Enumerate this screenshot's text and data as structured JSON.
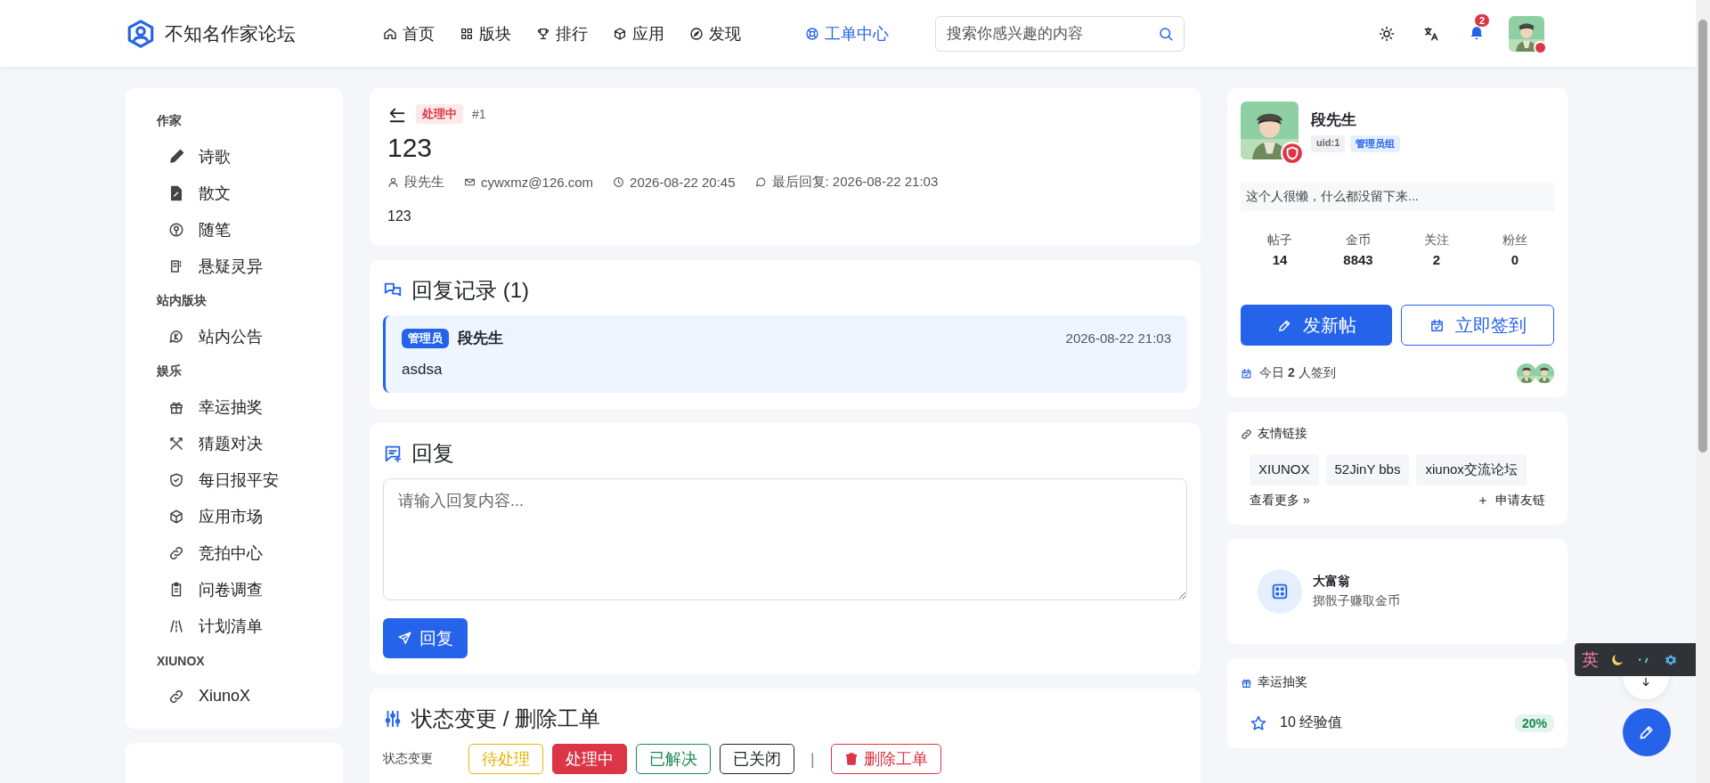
{
  "header": {
    "logo": "不知名作家论坛",
    "nav": [
      {
        "label": "首页",
        "selected": false
      },
      {
        "label": "版块",
        "selected": false
      },
      {
        "label": "排行",
        "selected": false
      },
      {
        "label": "应用",
        "selected": false
      },
      {
        "label": "发现",
        "selected": false
      },
      {
        "label": "工单中心",
        "selected": true
      }
    ],
    "search": {
      "placeholder": "搜索你感兴趣的内容"
    },
    "notification_count": "2"
  },
  "sidebar": {
    "groups": [
      {
        "title": "作家",
        "items": [
          {
            "label": "诗歌"
          },
          {
            "label": "散文"
          },
          {
            "label": "随笔"
          },
          {
            "label": "悬疑灵异"
          }
        ]
      },
      {
        "title": "站内版块",
        "items": [
          {
            "label": "站内公告"
          }
        ]
      },
      {
        "title": "娱乐",
        "items": [
          {
            "label": "幸运抽奖"
          },
          {
            "label": "猜题对决"
          },
          {
            "label": "每日报平安"
          },
          {
            "label": "应用市场"
          },
          {
            "label": "竞拍中心"
          },
          {
            "label": "问卷调查"
          },
          {
            "label": "计划清单"
          }
        ]
      },
      {
        "title": "XIUNOX",
        "items": [
          {
            "label": "XiunoX"
          }
        ]
      }
    ]
  },
  "ticket": {
    "status": "处理中",
    "number": "#1",
    "title": "123",
    "author": "段先生",
    "email": "cywxmz@126.com",
    "created": "2026-08-22 20:45",
    "last_reply": "最后回复: 2026-08-22 21:03",
    "body": "123"
  },
  "replies": {
    "title": "回复记录 (1)",
    "items": [
      {
        "role": "管理员",
        "name": "段先生",
        "time": "2026-08-22 21:03",
        "text": "asdsa"
      }
    ]
  },
  "reply_form": {
    "title": "回复",
    "placeholder": "请输入回复内容...",
    "button": "回复"
  },
  "status_change": {
    "title": "状态变更 / 删除工单",
    "label": "状态变更",
    "options": [
      {
        "label": "待处理",
        "color": "#eab308",
        "selected": false
      },
      {
        "label": "处理中",
        "color": "#dc3545",
        "selected": true
      },
      {
        "label": "已解决",
        "color": "#198754",
        "selected": false
      },
      {
        "label": "已关闭",
        "color": "#212529",
        "selected": false
      }
    ],
    "separator": "|",
    "delete": "删除工单"
  },
  "profile": {
    "name": "段先生",
    "uid": "uid:1",
    "group": "管理员组",
    "bio": "这个人很懒，什么都没留下来...",
    "stats": [
      {
        "label": "帖子",
        "value": "14"
      },
      {
        "label": "金币",
        "value": "8843"
      },
      {
        "label": "关注",
        "value": "2"
      },
      {
        "label": "粉丝",
        "value": "0"
      }
    ],
    "new_post": "发新帖",
    "check_in": "立即签到",
    "checked_in_today": "今日 **2** 人签到"
  },
  "friend_links": {
    "title": "友情链接",
    "links": [
      "XIUNOX",
      "52JinY bbs",
      "xiunox交流论坛"
    ],
    "more": "查看更多 »",
    "apply": "申请友链"
  },
  "monopoly": {
    "title": "大富翁",
    "subtitle": "掷骰子赚取金币"
  },
  "lucky_draw": {
    "title": "幸运抽奖",
    "prizes": [
      {
        "label": "10 经验值",
        "chance": "20%"
      }
    ]
  },
  "ime_toolbar": {
    "mode": "英"
  }
}
